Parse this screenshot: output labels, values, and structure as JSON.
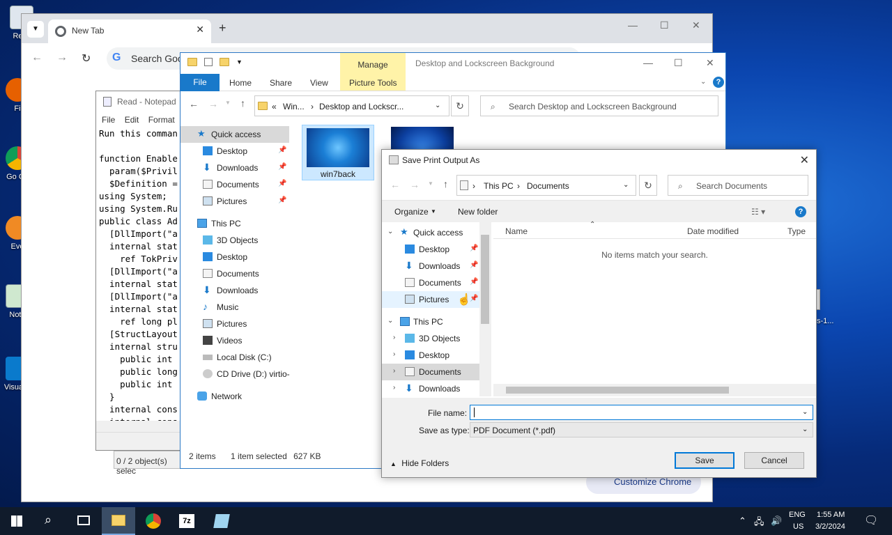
{
  "desktop": {
    "icons": [
      {
        "label": "Recy"
      },
      {
        "label": "Fi"
      },
      {
        "label": "Go Ch"
      },
      {
        "label": "Eve"
      },
      {
        "label": "Note"
      },
      {
        "label": "Visua C"
      }
    ],
    "right_label": "s-1..."
  },
  "chrome": {
    "tab_title": "New Tab",
    "tab_close": "✕",
    "new_tab": "+",
    "omnibox_placeholder": "Search Goo",
    "customize_label": "Customize Chrome",
    "back": "←",
    "forward": "→",
    "reload": "↻"
  },
  "notepad": {
    "title": "Read - Notepad",
    "menu": [
      "File",
      "Edit",
      "Format"
    ],
    "content": "Run this comman\n\nfunction Enable\n  param($Privil\n  $Definition =\nusing System;\nusing System.Ru\npublic class Ad\n  [DllImport(\"a\n  internal stat\n    ref TokPriv\n  [DllImport(\"a\n  internal stat\n  [DllImport(\"a\n  internal stat\n    ref long pl\n  [StructLayout\n  internal stru\n    public int\n    public long\n    public int\n  }\n  internal cons\n  internal cons"
  },
  "selection_status": "0 / 2 object(s) selec",
  "explorer": {
    "title": "Desktop and Lockscreen Background",
    "manage_tab": "Manage",
    "ribbon_tabs": [
      "File",
      "Home",
      "Share",
      "View",
      "Picture Tools"
    ],
    "address": {
      "prefix": "«",
      "part1": "Win...",
      "sep": "›",
      "part2": "Desktop and Lockscr..."
    },
    "search_placeholder": "Search Desktop and Lockscreen Background",
    "nav": [
      {
        "label": "Quick access",
        "icon": "star-icon",
        "pinned": false,
        "top": true,
        "selected": true
      },
      {
        "label": "Desktop",
        "icon": "desktop-icon",
        "pinned": true
      },
      {
        "label": "Downloads",
        "icon": "downloads-icon",
        "pinned": true
      },
      {
        "label": "Documents",
        "icon": "documents-icon",
        "pinned": true
      },
      {
        "label": "Pictures",
        "icon": "pictures-icon",
        "pinned": true
      },
      {
        "label": "This PC",
        "icon": "pc-icon",
        "top": true
      },
      {
        "label": "3D Objects",
        "icon": "3d-objects-icon"
      },
      {
        "label": "Desktop",
        "icon": "desktop-icon"
      },
      {
        "label": "Documents",
        "icon": "documents-icon"
      },
      {
        "label": "Downloads",
        "icon": "downloads-icon"
      },
      {
        "label": "Music",
        "icon": "music-icon"
      },
      {
        "label": "Pictures",
        "icon": "pictures-icon"
      },
      {
        "label": "Videos",
        "icon": "videos-icon"
      },
      {
        "label": "Local Disk (C:)",
        "icon": "disk-icon"
      },
      {
        "label": "CD Drive (D:) virtio-",
        "icon": "cd-drive-icon"
      },
      {
        "label": "Network",
        "icon": "network-icon",
        "top": true
      }
    ],
    "file_label": "win7back",
    "status": {
      "items": "2 items",
      "selected": "1 item selected",
      "size": "627 KB"
    }
  },
  "dialog": {
    "title": "Save Print Output As",
    "address": {
      "part1": "This PC",
      "part2": "Documents"
    },
    "search_placeholder": "Search Documents",
    "organize": "Organize",
    "new_folder": "New folder",
    "tree": [
      {
        "label": "Quick access",
        "icon": "star-icon",
        "arrow": "expanded",
        "level": 0
      },
      {
        "label": "Desktop",
        "icon": "desktop-icon",
        "pinned": true,
        "level": 1
      },
      {
        "label": "Downloads",
        "icon": "downloads-icon",
        "pinned": true,
        "level": 1
      },
      {
        "label": "Documents",
        "icon": "documents-icon",
        "pinned": true,
        "level": 1
      },
      {
        "label": "Pictures",
        "icon": "pictures-icon",
        "pinned": true,
        "level": 1,
        "hover": true
      },
      {
        "label": "This PC",
        "icon": "pc-icon",
        "arrow": "expanded",
        "level": 0
      },
      {
        "label": "3D Objects",
        "icon": "3d-objects-icon",
        "arrow": "collapsed",
        "level": 1
      },
      {
        "label": "Desktop",
        "icon": "desktop-icon",
        "arrow": "collapsed",
        "level": 1
      },
      {
        "label": "Documents",
        "icon": "documents-icon",
        "arrow": "collapsed",
        "level": 1,
        "selected": true
      },
      {
        "label": "Downloads",
        "icon": "downloads-icon",
        "arrow": "collapsed",
        "level": 1
      }
    ],
    "columns": [
      "Name",
      "Date modified",
      "Type"
    ],
    "empty_message": "No items match your search.",
    "file_name_label": "File name:",
    "file_name_value": "",
    "save_type_label": "Save as type:",
    "save_type_value": "PDF Document (*.pdf)",
    "hide_folders": "Hide Folders",
    "save_button": "Save",
    "cancel_button": "Cancel"
  },
  "taskbar": {
    "lang1": "ENG",
    "lang2": "US",
    "time": "1:55 AM",
    "date": "3/2/2024",
    "apps": [
      "file-explorer-icon",
      "chrome-icon",
      "7zip-icon",
      "notepad-icon"
    ]
  }
}
